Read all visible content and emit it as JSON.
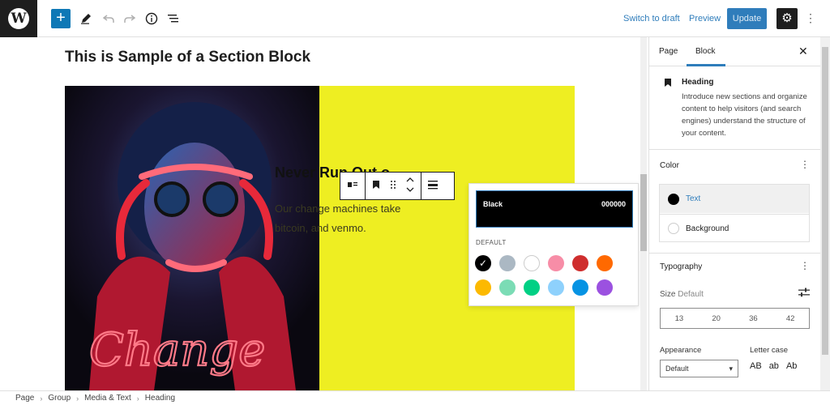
{
  "topbar": {
    "logo_glyph": "W",
    "add_glyph": "+",
    "switch_to_draft": "Switch to draft",
    "preview": "Preview",
    "update": "Update",
    "settings_glyph": "⚙",
    "more_glyph": "⋮",
    "icons": [
      "pencil-icon",
      "undo-icon",
      "redo-icon",
      "info-icon",
      "list-view-icon"
    ]
  },
  "canvas": {
    "section_title": "This is Sample of a Section Block",
    "heading": "Never Run Out o",
    "paragraph_line1": "Our change machines take",
    "paragraph_line2": "bitcoin, and venmo.",
    "media_text": "Change",
    "accent_color": "#eeee22"
  },
  "color_popover": {
    "selected_name": "Black",
    "selected_hex": "000000",
    "palette_label": "DEFAULT",
    "swatches": [
      {
        "name": "black",
        "color": "#000000",
        "selected": true
      },
      {
        "name": "cyan-bluish-gray",
        "color": "#abb8c3"
      },
      {
        "name": "white",
        "color": "#ffffff"
      },
      {
        "name": "pale-pink",
        "color": "#f78da7"
      },
      {
        "name": "vivid-red",
        "color": "#cf2e2e"
      },
      {
        "name": "luminous-vivid-orange",
        "color": "#ff6900"
      },
      {
        "name": "luminous-vivid-amber",
        "color": "#fcb900"
      },
      {
        "name": "light-green-cyan",
        "color": "#7bdcb5"
      },
      {
        "name": "vivid-green-cyan",
        "color": "#00d084"
      },
      {
        "name": "pale-cyan-blue",
        "color": "#8ed1fc"
      },
      {
        "name": "vivid-cyan-blue",
        "color": "#0693e3"
      },
      {
        "name": "vivid-purple",
        "color": "#9b51e0"
      }
    ]
  },
  "sidebar": {
    "tab_page": "Page",
    "tab_block": "Block",
    "close_glyph": "✕",
    "block_title": "Heading",
    "block_description": "Introduce new sections and organize content to help visitors (and search engines) understand the structure of your content.",
    "color_panel_title": "Color",
    "color_text_label": "Text",
    "color_background_label": "Background",
    "typography_title": "Typography",
    "size_label_prefix": "Size",
    "size_label_value": "Default",
    "font_sizes": [
      "13",
      "20",
      "36",
      "42"
    ],
    "appearance_label": "Appearance",
    "appearance_value": "Default",
    "letter_case_label": "Letter case",
    "letter_case_options": [
      "AB",
      "ab",
      "Ab"
    ],
    "kebab_glyph": "⋮"
  },
  "breadcrumb": [
    "Page",
    "Group",
    "Media & Text",
    "Heading"
  ]
}
